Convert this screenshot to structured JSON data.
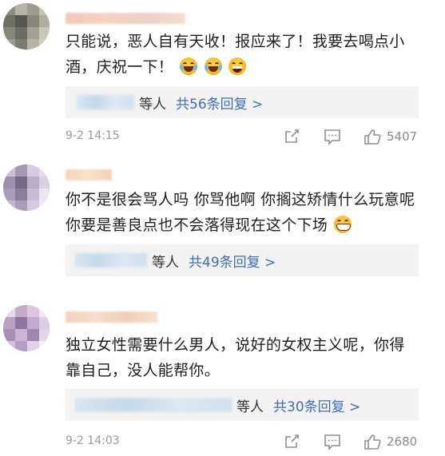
{
  "comments": [
    {
      "text": "只能说，恶人自有天收！报应来了！我要去喝点小酒，庆祝一下！",
      "reply_who": "等人",
      "reply_count": "共56条回复 >",
      "time": "9-2 14:15",
      "likes": "5407",
      "emojis": [
        "laugh-cry-emoji",
        "laugh-cry-emoji",
        "grin-emoji"
      ]
    },
    {
      "text": "你不是很会骂人吗 你骂他啊 你搁这矫情什么玩意呢 你要是善良点也不会落得现在这个下场",
      "reply_who": "等人",
      "reply_count": "共49条回复 >",
      "emojis": [
        "grin-teeth-emoji"
      ]
    },
    {
      "text": "独立女性需要什么男人，说好的女权主义呢，你得靠自己，没人能帮你。",
      "reply_who": "等人",
      "reply_count": "共30条回复 >",
      "time": "9-2 14:03",
      "likes": "2680"
    }
  ],
  "icons": {
    "share": "share-icon",
    "comment": "comment-icon",
    "like": "thumbs-up-icon"
  },
  "colors": {
    "link": "#3f6fb5",
    "meta": "#9a9a9a",
    "reply_bg": "#f3f3f3"
  }
}
